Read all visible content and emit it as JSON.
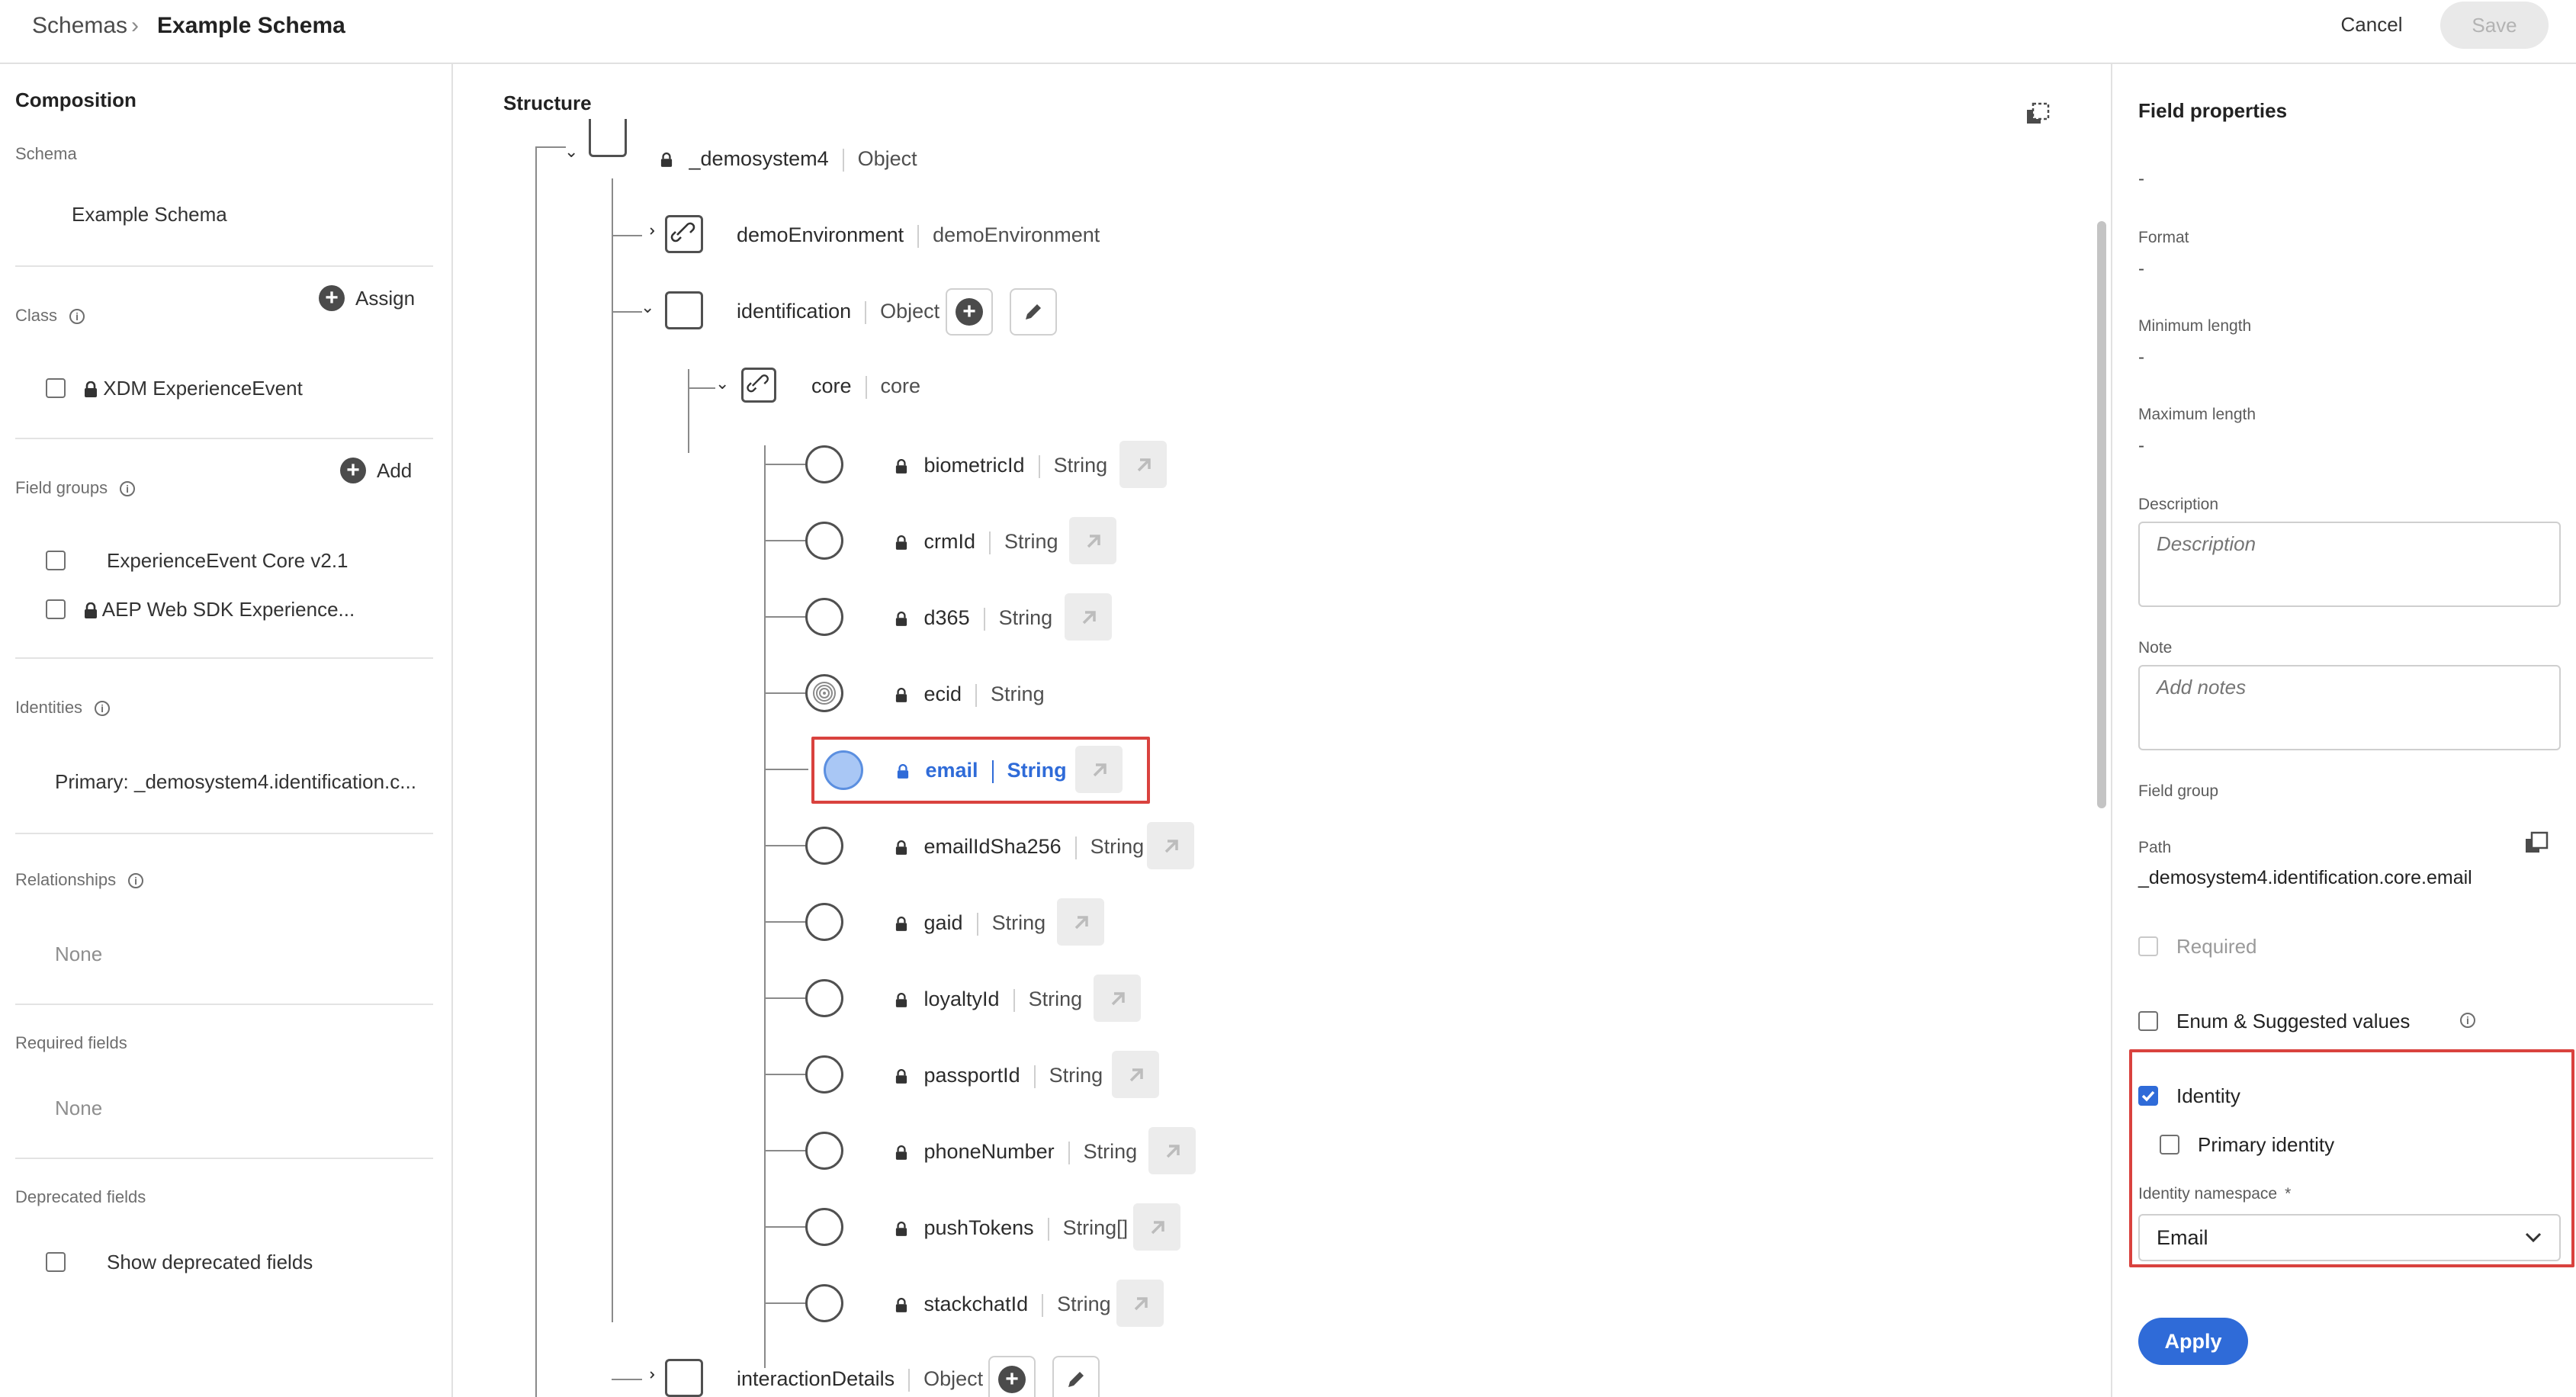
{
  "breadcrumb": {
    "parent": "Schemas",
    "current": "Example Schema"
  },
  "toolbar": {
    "cancel": "Cancel",
    "save": "Save"
  },
  "left": {
    "composition_title": "Composition",
    "schema_label": "Schema",
    "schema_name": "Example Schema",
    "class_label": "Class",
    "assign_label": "Assign",
    "class_item": "XDM ExperienceEvent",
    "field_groups_label": "Field groups",
    "add_label": "Add",
    "field_groups": [
      "ExperienceEvent Core v2.1",
      "AEP Web SDK Experience..."
    ],
    "identities_label": "Identities",
    "identities_value": "Primary: _demosystem4.identification.c...",
    "relationships_label": "Relationships",
    "relationships_value": "None",
    "required_label": "Required fields",
    "required_value": "None",
    "deprecated_label": "Deprecated fields",
    "deprecated_toggle": "Show deprecated fields"
  },
  "structure": {
    "title": "Structure",
    "root": {
      "name": "_demosystem4",
      "type": "Object"
    },
    "demoEnvironment": {
      "name": "demoEnvironment",
      "type": "demoEnvironment"
    },
    "identification": {
      "name": "identification",
      "type": "Object"
    },
    "core": {
      "name": "core",
      "type": "core"
    },
    "fields": [
      {
        "name": "biometricId",
        "type": "String"
      },
      {
        "name": "crmId",
        "type": "String"
      },
      {
        "name": "d365",
        "type": "String"
      },
      {
        "name": "ecid",
        "type": "String"
      },
      {
        "name": "email",
        "type": "String"
      },
      {
        "name": "emailIdSha256",
        "type": "String"
      },
      {
        "name": "gaid",
        "type": "String"
      },
      {
        "name": "loyaltyId",
        "type": "String"
      },
      {
        "name": "passportId",
        "type": "String"
      },
      {
        "name": "phoneNumber",
        "type": "String"
      },
      {
        "name": "pushTokens",
        "type": "String[]"
      },
      {
        "name": "stackchatId",
        "type": "String"
      }
    ],
    "interactionDetails": {
      "name": "interactionDetails",
      "type": "Object"
    }
  },
  "props": {
    "title": "Field properties",
    "type_value": "-",
    "format_label": "Format",
    "format_value": "-",
    "minlen_label": "Minimum length",
    "minlen_value": "-",
    "maxlen_label": "Maximum length",
    "maxlen_value": "-",
    "description_label": "Description",
    "description_placeholder": "Description",
    "note_label": "Note",
    "note_placeholder": "Add notes",
    "field_group_label": "Field group",
    "path_label": "Path",
    "path_value": "_demosystem4.identification.core.email",
    "required_label": "Required",
    "enum_label": "Enum & Suggested values",
    "identity_label": "Identity",
    "primary_identity_label": "Primary identity",
    "namespace_label": "Identity namespace",
    "namespace_value": "Email",
    "apply": "Apply"
  },
  "colors": {
    "accent": "#2f6bd8",
    "highlight": "#d9423e",
    "selected_fill": "#a9c7f5"
  }
}
